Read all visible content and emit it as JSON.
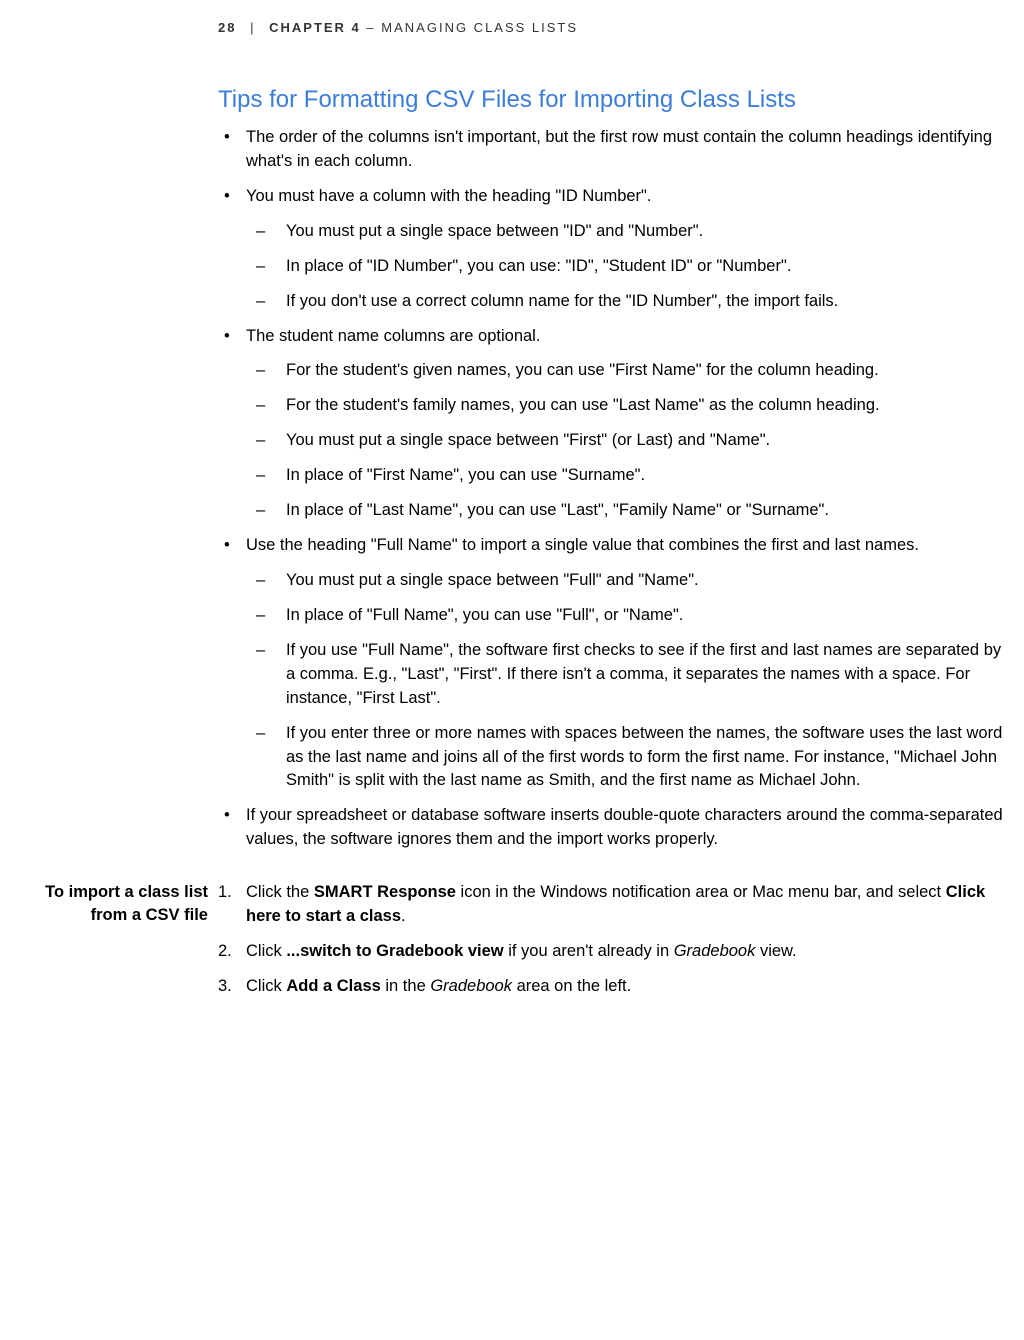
{
  "header": {
    "page_number": "28",
    "divider": "|",
    "chapter_label": "CHAPTER 4",
    "separator": "–",
    "chapter_title": "MANAGING CLASS LISTS"
  },
  "section_title": "Tips for Formatting CSV Files for Importing Class Lists",
  "bullets": [
    {
      "text": "The order of the columns isn't important, but the first row must contain the column headings identifying what's in each column."
    },
    {
      "text": "You must have a column with the heading \"ID Number\".",
      "subs": [
        "You must put a single space between \"ID\" and \"Number\".",
        "In place of \"ID Number\", you can use: \"ID\", \"Student ID\" or \"Number\".",
        "If you don't use a correct column name for the \"ID Number\", the import fails."
      ]
    },
    {
      "text": "The student name columns are optional.",
      "subs": [
        "For the student's given names, you can use \"First Name\" for the column heading.",
        "For the student's family names, you can use \"Last Name\" as the column heading.",
        "You must put a single space between \"First\" (or Last) and \"Name\".",
        "In place of \"First Name\", you can use \"Surname\".",
        "In place of \"Last Name\", you can use \"Last\", \"Family Name\" or \"Surname\"."
      ]
    },
    {
      "text": "Use the heading \"Full Name\" to import a single value that combines the first and last names.",
      "subs": [
        "You must put a single space between \"Full\" and \"Name\".",
        "In place of \"Full Name\", you can use \"Full\", or \"Name\".",
        "If you use \"Full Name\", the software first checks to see if the first and last names are separated by a comma. E.g., \"Last\", \"First\". If there isn't a comma, it separates the names with a space. For instance, \"First Last\".",
        "If you enter three or more names with spaces between the names, the software uses the last word as the last name and joins all of the first words to form the first name. For instance, \"Michael John Smith\" is split with the last name as Smith, and the first name as Michael John."
      ]
    },
    {
      "text": "If your spreadsheet or database software inserts double-quote characters around the comma-separated values, the software ignores them and the import works properly."
    }
  ],
  "sidebar_heading": "To import a class list from a CSV file",
  "ordered": [
    {
      "num": "1.",
      "parts": [
        {
          "t": "Click the "
        },
        {
          "t": "SMART Response",
          "bold": true
        },
        {
          "t": " icon in the Windows notification area or Mac menu bar, and select "
        },
        {
          "t": "Click here to start a class",
          "bold": true
        },
        {
          "t": "."
        }
      ]
    },
    {
      "num": "2.",
      "parts": [
        {
          "t": "Click "
        },
        {
          "t": "...switch to Gradebook view",
          "bold": true
        },
        {
          "t": " if you aren't already in "
        },
        {
          "t": "Gradebook",
          "italic": true
        },
        {
          "t": " view."
        }
      ]
    },
    {
      "num": "3.",
      "parts": [
        {
          "t": "Click "
        },
        {
          "t": "Add a Class",
          "bold": true
        },
        {
          "t": " in the "
        },
        {
          "t": "Gradebook",
          "italic": true
        },
        {
          "t": " area on the left."
        }
      ]
    }
  ]
}
